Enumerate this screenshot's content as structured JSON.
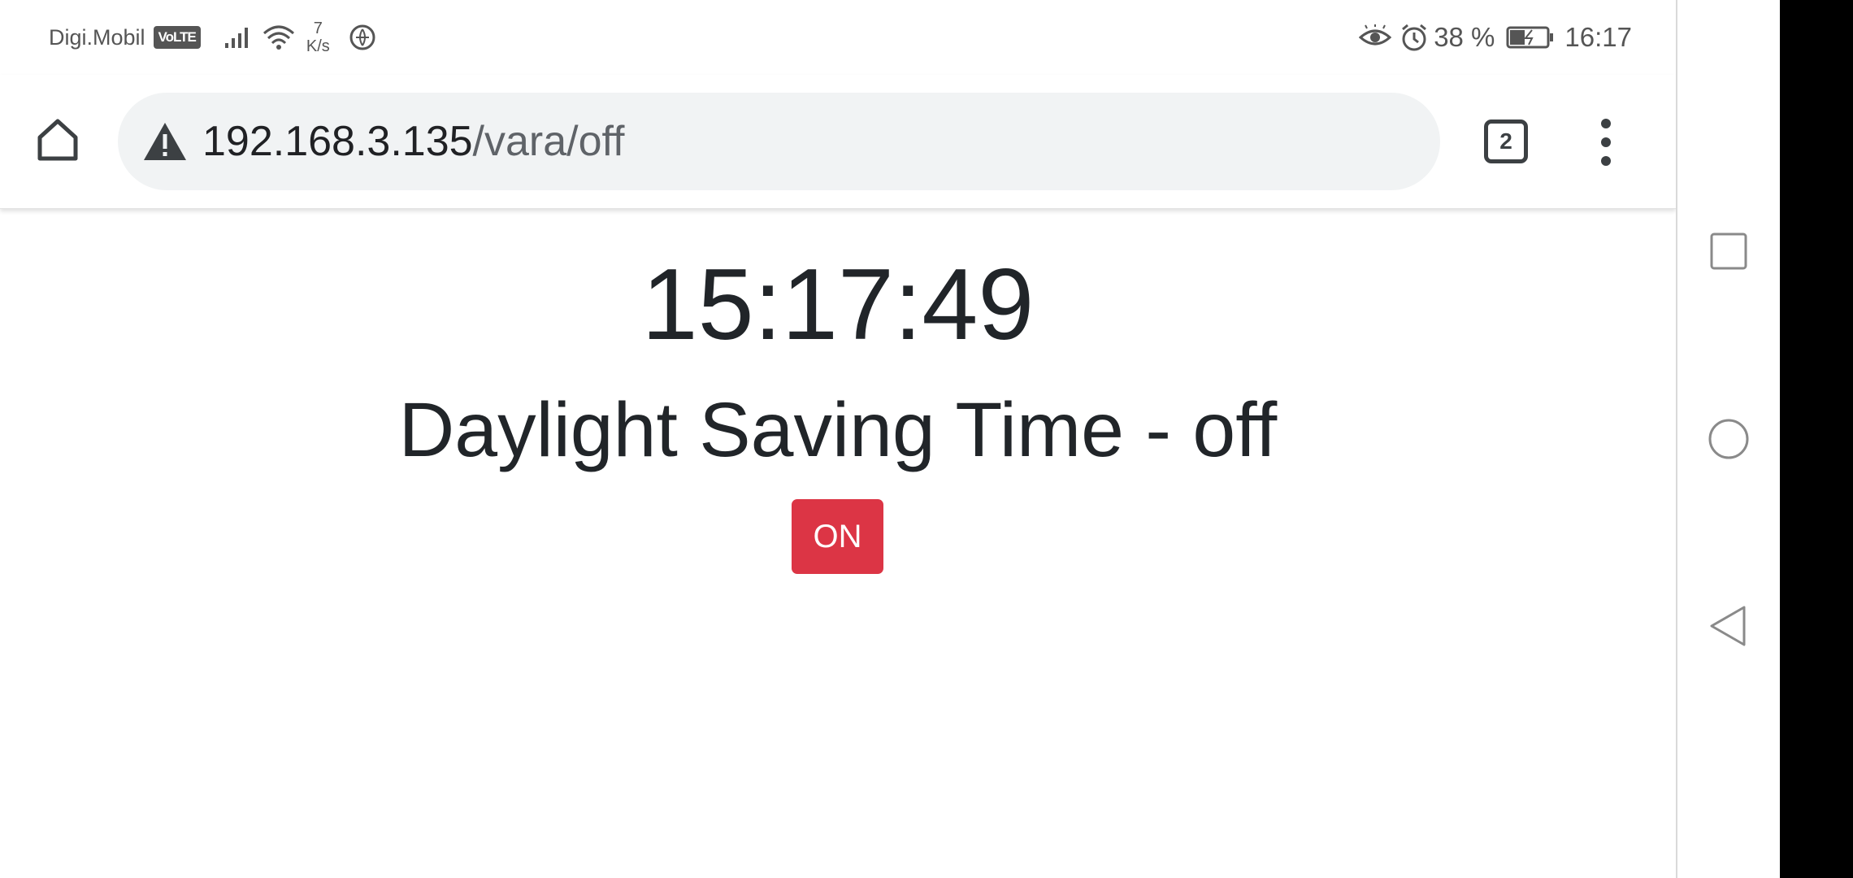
{
  "status_bar": {
    "carrier": "Digi.Mobil",
    "volte_label": "VoLTE",
    "net_speed_value": "7",
    "net_speed_unit": "K/s",
    "battery_percent": "38 %",
    "time": "16:17",
    "icons": [
      "signal-icon",
      "wifi-icon",
      "vpn-icon",
      "eye-comfort-icon",
      "alarm-icon",
      "battery-icon"
    ]
  },
  "browser": {
    "url_host": "192.168.3.135",
    "url_path": "/vara/off",
    "tab_count": "2",
    "icons": [
      "home-icon",
      "warning-icon",
      "tab-switcher-icon",
      "menu-icon"
    ]
  },
  "page": {
    "clock": "15:17:49",
    "heading": "Daylight Saving Time - off",
    "toggle_button_label": "ON",
    "toggle_button_color": "#dc3545",
    "text_color": "#212529"
  },
  "nav_bar": {
    "icons": [
      "recent-apps-icon",
      "home-circle-icon",
      "back-icon"
    ]
  }
}
